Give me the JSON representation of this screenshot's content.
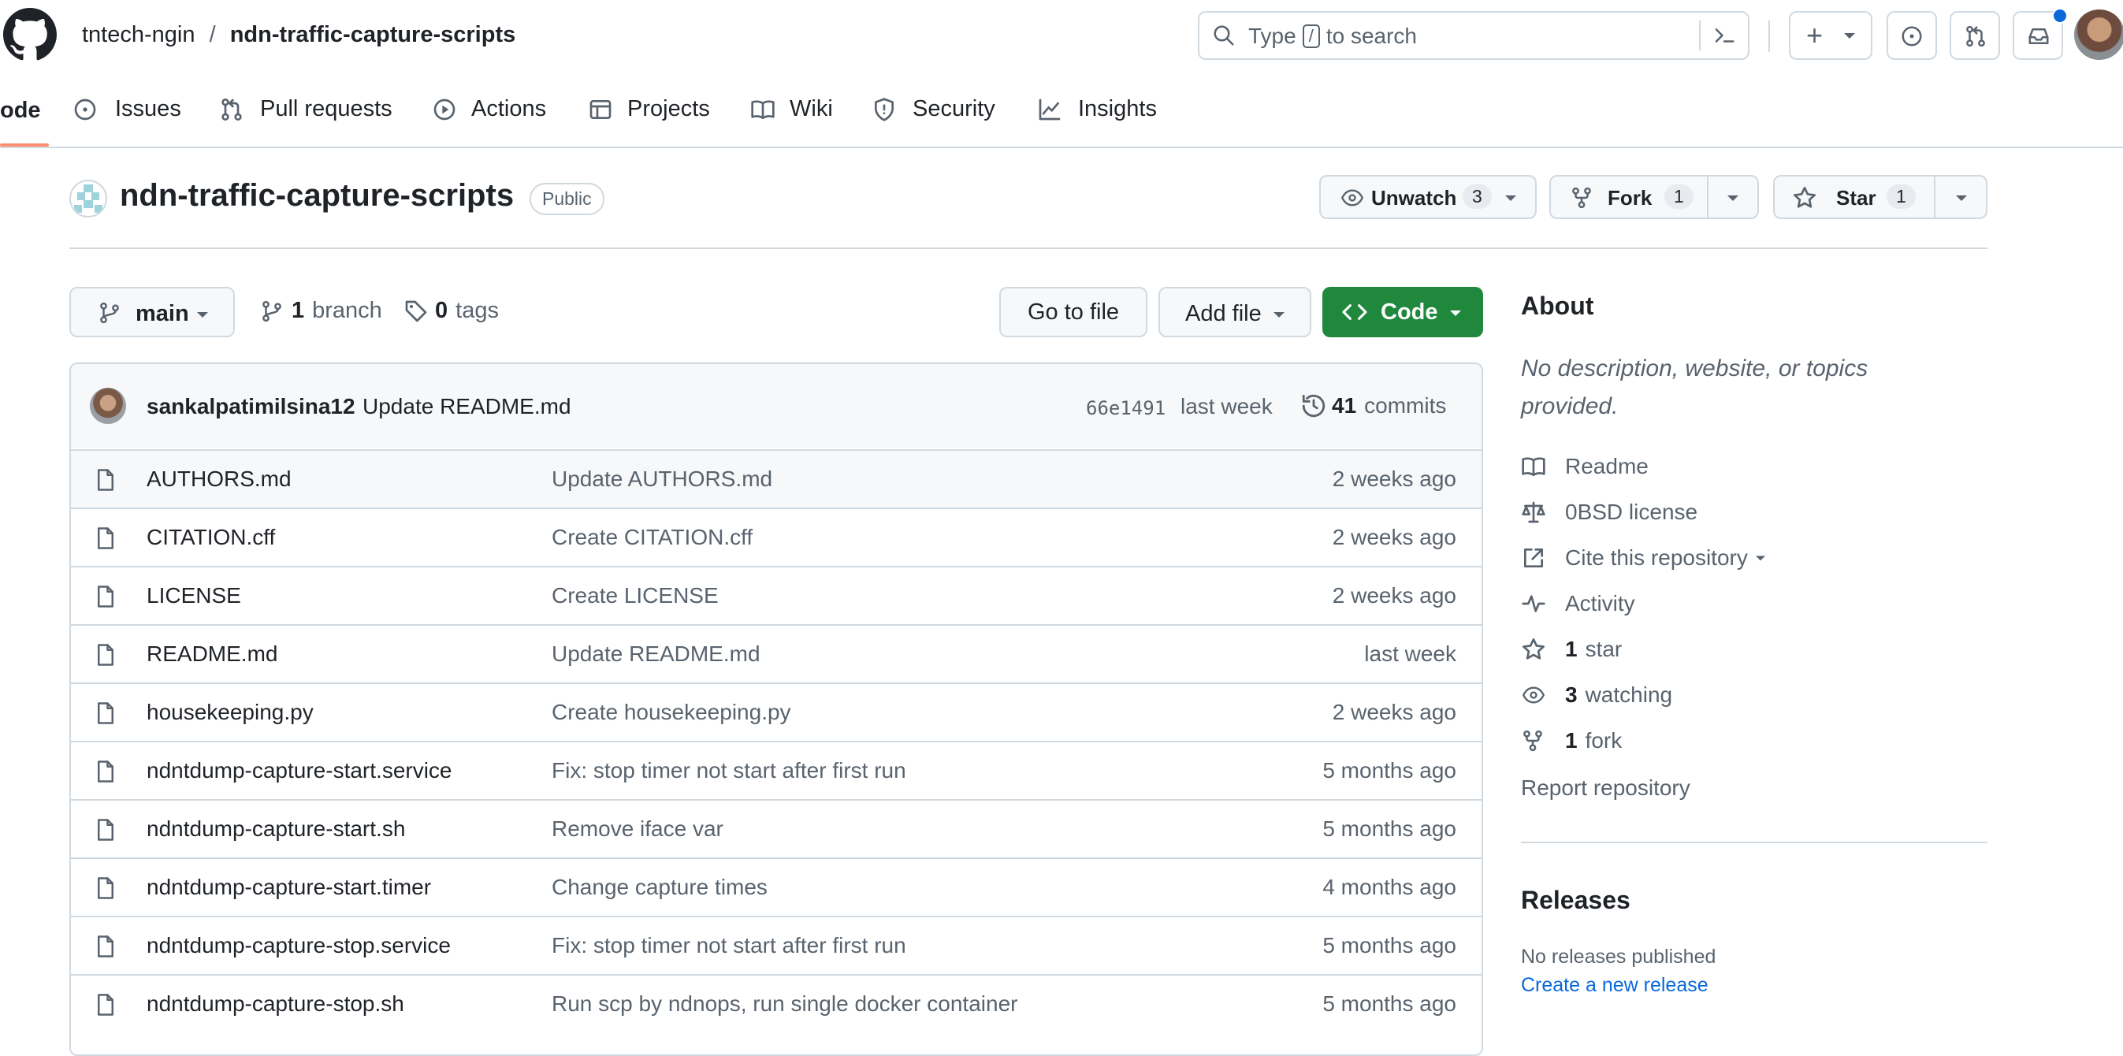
{
  "header": {
    "owner": "tntech-ngin",
    "separator": "/",
    "repo": "ndn-traffic-capture-scripts",
    "search_prefix": "Type",
    "search_key": "/",
    "search_suffix": "to search",
    "plus": "+"
  },
  "nav": {
    "code": "ode",
    "issues": "Issues",
    "pulls": "Pull requests",
    "actions": "Actions",
    "projects": "Projects",
    "wiki": "Wiki",
    "security": "Security",
    "insights": "Insights"
  },
  "repo_header": {
    "name": "ndn-traffic-capture-scripts",
    "visibility": "Public",
    "unwatch_label": "Unwatch",
    "unwatch_count": "3",
    "fork_label": "Fork",
    "fork_count": "1",
    "star_label": "Star",
    "star_count": "1"
  },
  "toolbar": {
    "branch": "main",
    "branch_count": "1",
    "branch_label": "branch",
    "tag_count": "0",
    "tag_label": "tags",
    "go_to_file": "Go to file",
    "add_file": "Add file",
    "code": "Code"
  },
  "commit": {
    "author": "sankalpatimilsina12",
    "message": "Update README.md",
    "sha": "66e1491",
    "time": "last week",
    "count": "41",
    "count_label": "commits"
  },
  "files": [
    {
      "name": "AUTHORS.md",
      "message": "Update AUTHORS.md",
      "age": "2 weeks ago"
    },
    {
      "name": "CITATION.cff",
      "message": "Create CITATION.cff",
      "age": "2 weeks ago"
    },
    {
      "name": "LICENSE",
      "message": "Create LICENSE",
      "age": "2 weeks ago"
    },
    {
      "name": "README.md",
      "message": "Update README.md",
      "age": "last week"
    },
    {
      "name": "housekeeping.py",
      "message": "Create housekeeping.py",
      "age": "2 weeks ago"
    },
    {
      "name": "ndntdump-capture-start.service",
      "message": "Fix: stop timer not start after first run",
      "age": "5 months ago"
    },
    {
      "name": "ndntdump-capture-start.sh",
      "message": "Remove iface var",
      "age": "5 months ago"
    },
    {
      "name": "ndntdump-capture-start.timer",
      "message": "Change capture times",
      "age": "4 months ago"
    },
    {
      "name": "ndntdump-capture-stop.service",
      "message": "Fix: stop timer not start after first run",
      "age": "5 months ago"
    },
    {
      "name": "ndntdump-capture-stop.sh",
      "message": "Run scp by ndnops, run single docker container",
      "age": "5 months ago"
    }
  ],
  "about": {
    "title": "About",
    "description": "No description, website, or topics provided.",
    "readme": "Readme",
    "license": "0BSD license",
    "cite": "Cite this repository",
    "activity": "Activity",
    "stars_count": "1",
    "stars_label": "star",
    "watching_count": "3",
    "watching_label": "watching",
    "forks_count": "1",
    "forks_label": "fork",
    "report": "Report repository"
  },
  "releases": {
    "title": "Releases",
    "none": "No releases published",
    "create": "Create a new release"
  },
  "colors": {
    "accent": "#0969da",
    "code_button": "#1f883d",
    "active_tab": "#fd8c73",
    "notification": "#0969da"
  }
}
